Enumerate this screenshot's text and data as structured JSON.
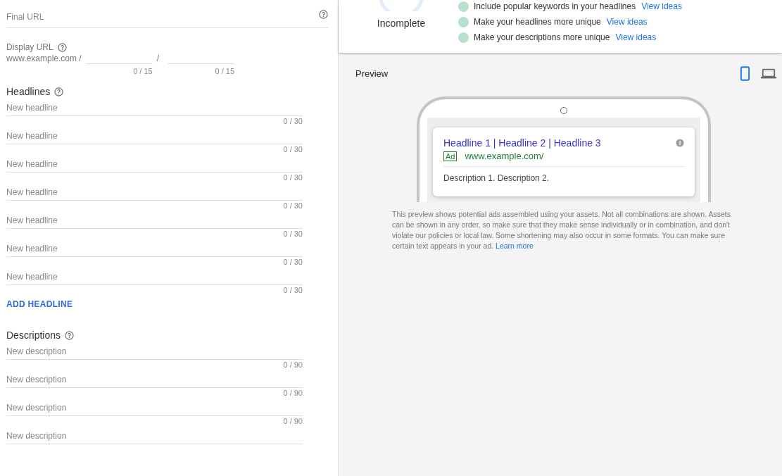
{
  "final_url": {
    "placeholder": "Final URL"
  },
  "display_url": {
    "label": "Display URL",
    "domain": "www.example.com /",
    "separator": "/",
    "paths": [
      {
        "counter": "0 / 15"
      },
      {
        "counter": "0 / 15"
      }
    ]
  },
  "headlines": {
    "title": "Headlines",
    "items": [
      {
        "placeholder": "New headline",
        "counter": "0 / 30"
      },
      {
        "placeholder": "New headline",
        "counter": "0 / 30"
      },
      {
        "placeholder": "New headline",
        "counter": "0 / 30"
      },
      {
        "placeholder": "New headline",
        "counter": "0 / 30"
      },
      {
        "placeholder": "New headline",
        "counter": "0 / 30"
      },
      {
        "placeholder": "New headline",
        "counter": "0 / 30"
      },
      {
        "placeholder": "New headline",
        "counter": "0 / 30"
      }
    ],
    "add_button": "ADD HEADLINE"
  },
  "descriptions": {
    "title": "Descriptions",
    "items": [
      {
        "placeholder": "New description",
        "counter": "0 / 90"
      },
      {
        "placeholder": "New description",
        "counter": "0 / 90"
      },
      {
        "placeholder": "New description",
        "counter": "0 / 90"
      },
      {
        "placeholder": "New description"
      }
    ]
  },
  "ad_strength": {
    "status": "Incomplete",
    "tips": [
      {
        "text": "Include popular keywords in your headlines",
        "link": "View ideas"
      },
      {
        "text": "Make your headlines more unique",
        "link": "View ideas"
      },
      {
        "text": "Make your descriptions more unique",
        "link": "View ideas"
      }
    ]
  },
  "preview": {
    "title": "Preview",
    "devices": [
      {
        "kind": "mobile",
        "selected": true
      },
      {
        "kind": "desktop",
        "selected": false
      }
    ],
    "ad": {
      "headline": "Headline 1 | Headline 2 | Headline 3",
      "badge": "Ad",
      "url": "www.example.com/",
      "description": "Description 1. Description 2."
    },
    "disclaimer": "This preview shows potential ads assembled using your assets. Not all combinations are shown. Assets can be shown in any order, so make sure that they make sense individually or in combination, and don't violate our policies or local law. Some shortening may also occur in some formats. You can make sure certain text appears in your ad.",
    "disclaimer_link": "Learn more"
  }
}
